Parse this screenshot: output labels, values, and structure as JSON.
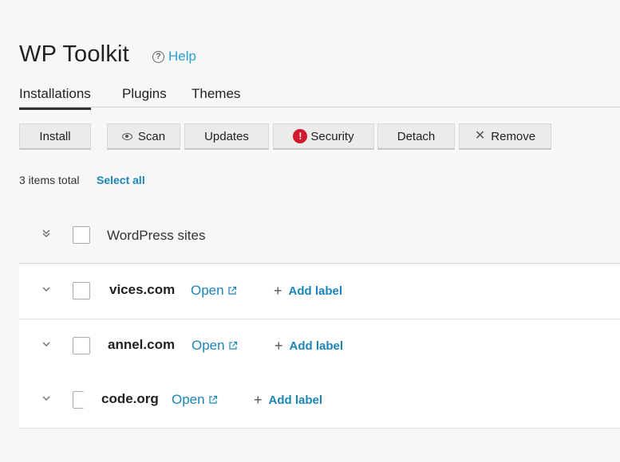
{
  "header": {
    "title": "WP Toolkit",
    "help_label": "Help"
  },
  "tabs": [
    {
      "label": "Installations",
      "active": true
    },
    {
      "label": "Plugins",
      "active": false
    },
    {
      "label": "Themes",
      "active": false
    }
  ],
  "toolbar": {
    "install": "Install",
    "scan": "Scan",
    "updates": "Updates",
    "security": "Security",
    "detach": "Detach",
    "remove": "Remove"
  },
  "list": {
    "count_text": "3 items total",
    "select_all": "Select all",
    "group_label": "WordPress sites",
    "open_label": "Open",
    "add_label": "Add label",
    "sites": [
      {
        "name": "vices.com"
      },
      {
        "name": "annel.com"
      },
      {
        "name": "code.org"
      }
    ]
  },
  "colors": {
    "link": "#1a86b8",
    "security_alert": "#d0192e"
  },
  "icons": [
    "question-circle-icon",
    "eye-icon",
    "alert-icon",
    "x-icon",
    "chevron-down-icon",
    "double-chevron-down-icon",
    "external-link-icon",
    "plus-icon"
  ]
}
